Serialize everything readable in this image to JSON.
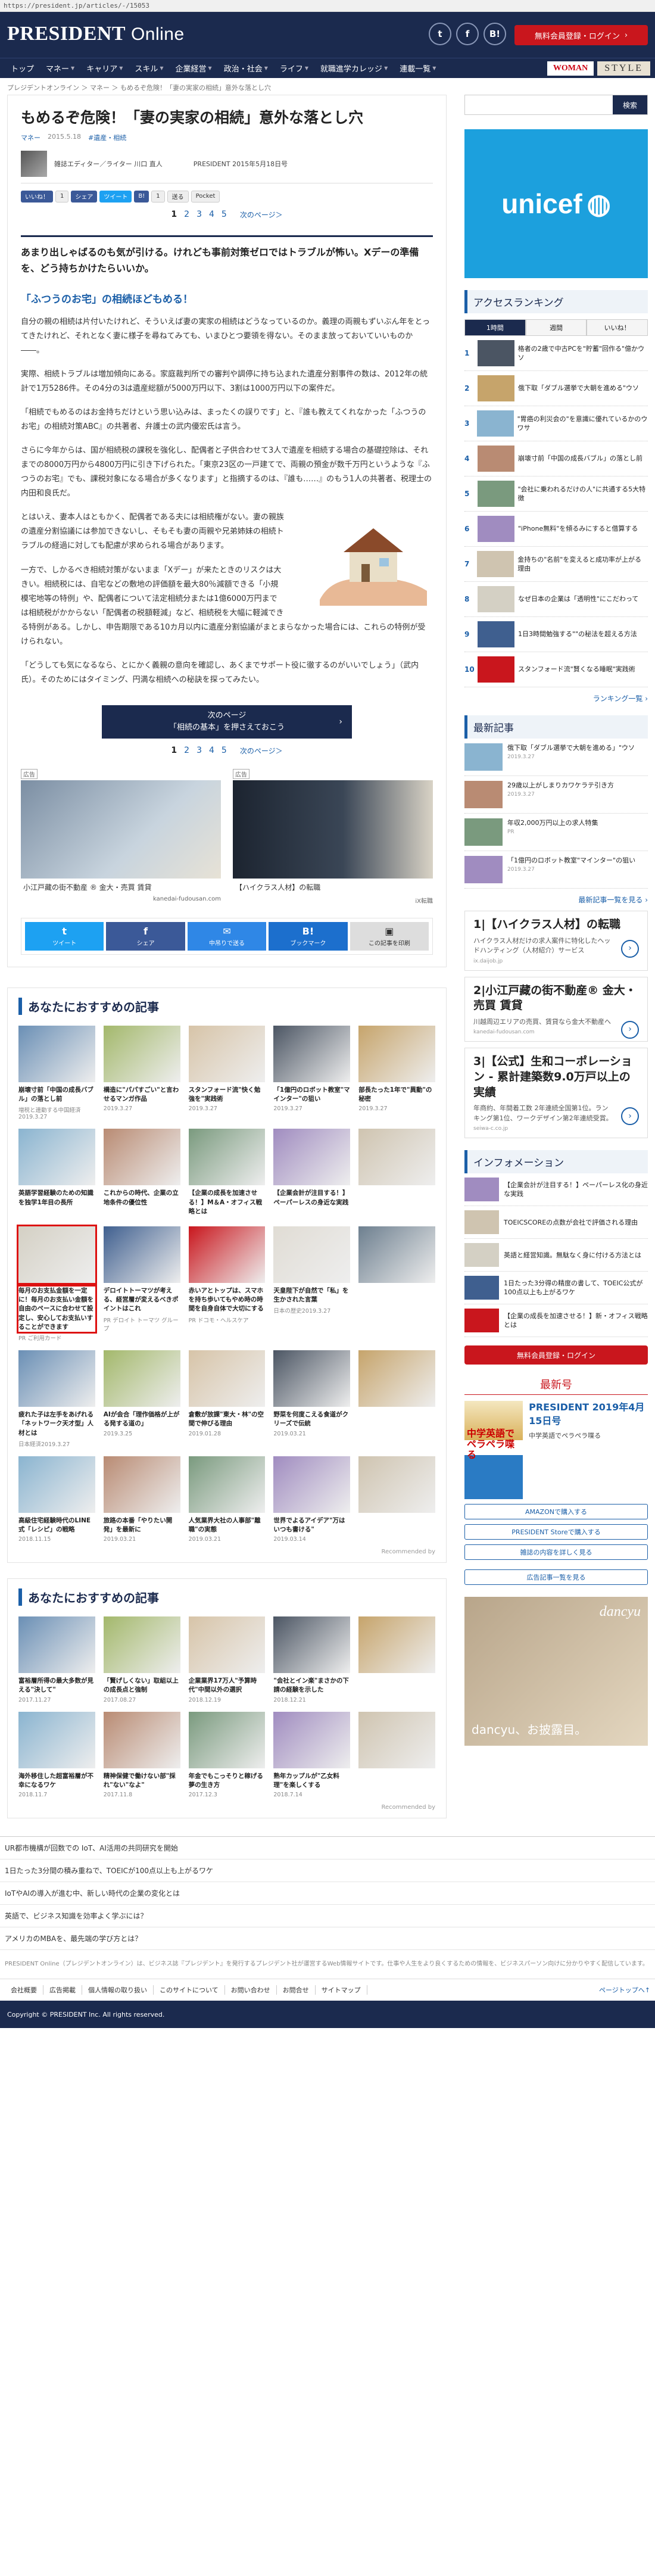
{
  "url": "https://president.jp/articles/-/15053",
  "header": {
    "logo_main": "PRESIDENT",
    "logo_sub": " Online",
    "share_t": "t",
    "share_f": "f",
    "share_b": "B!",
    "login": "無料会員登録・ログイン"
  },
  "nav": {
    "items": [
      "トップ",
      "マネー",
      "キャリア",
      "スキル",
      "企業経営",
      "政治・社会",
      "ライフ",
      "就職進学カレッジ",
      "連載一覧"
    ],
    "woman": "WOMAN",
    "style": "STYLE"
  },
  "breadcrumb": "プレジデントオンライン ＞ マネー ＞ もめるぞ危険！「妻の実家の相続」意外な落とし穴",
  "article": {
    "title": "もめるぞ危険！「妻の実家の相続」意外な落とし穴",
    "category": "マネー",
    "date": "2015.5.18",
    "genre": "#遺産・相続",
    "author_role": "雑誌エディター／ライター 川口 直人",
    "publication": "PRESIDENT 2015年5月18日号",
    "share": {
      "like": "いいね！",
      "fb_count": "1",
      "share": "シェア",
      "tweet": "ツイート",
      "b": "B!",
      "count": "1",
      "send": "送る",
      "pocket": "Pocket"
    },
    "pages": [
      "1",
      "2",
      "3",
      "4",
      "5"
    ],
    "next": "次のページ＞",
    "lead": "あまり出しゃばるのも気が引ける。けれども事前対策ゼロではトラブルが怖い。Xデーの準備を、どう持ちかけたらいいか。",
    "subhead": "「ふつうのお宅」の相続ほどもめる！",
    "paras": [
      "自分の親の相続は片付いたけれど、そういえば妻の実家の相続はどうなっているのか。義理の両親もずいぶん年をとってきたけれど、それとなく妻に様子を尋ねてみても、いまひとつ要領を得ない。そのまま放っておいていいものか――。",
      "実際、相続トラブルは増加傾向にある。家庭裁判所での審判や調停に持ち込まれた遺産分割事件の数は、2012年の統計で1万5286件。その4分の3は遺産総額が5000万円以下、3割は1000万円以下の案件だ。",
      "「相続でもめるのはお金持ちだけという思い込みは、まったくの誤りです」と、『誰も教えてくれなかった「ふつうのお宅」の相続対策ABC』の共著者、弁護士の武内優宏氏は言う。",
      "さらに今年からは、国が相続税の課税を強化し、配偶者と子供合わせて3人で遺産を相続する場合の基礎控除は、それまでの8000万円から4800万円に引き下げられた。「東京23区の一戸建てで、両親の預金が数千万円というような『ふつうのお宅』でも、課税対象になる場合が多くなります」と指摘するのは、『誰も……』のもう1人の共著者、税理士の内田和良氏だ。",
      "とはいえ、妻本人はともかく、配偶者である夫には相続権がない。妻の親族の遺産分割協議には参加できないし、そもそも妻の両親や兄弟姉妹の相続トラブルの経過に対しても配慮が求められる場合があります。",
      "一方で、しかるべき相続対策がないまま「Xデー」が来たときのリスクは大きい。相続税には、自宅などの敷地の評価額を最大80％減額できる「小規模宅地等の特例」や、配偶者について法定相続分または1億6000万円までは相続税がかからない「配偶者の税額軽減」など、相続税を大幅に軽減できる特例がある。しかし、申告期限である10カ月以内に遺産分割協議がまとまらなかった場合には、これらの特例が受けられない。",
      "「どうしても気になるなら、とにかく義親の意向を確認し、あくまでサポート役に徹するのがいいでしょう」（武内氏）。そのためにはタイミング、円満な相続への秘訣を探ってみたい。"
    ],
    "next_cta_1": "次のページ",
    "next_cta_2": "「相続の基本」を押さえておこう"
  },
  "ads": [
    {
      "label": "広告",
      "caption": "小江戸藏の街不動産 ® 金大・売買 賃貸",
      "sub": "kanedai-fudousan.com"
    },
    {
      "label": "広告",
      "caption": "【ハイクラス人材】の転職",
      "sub": "iX転職"
    }
  ],
  "share_bar": [
    {
      "ic": "t",
      "label": "ツイート"
    },
    {
      "ic": "f",
      "label": "シェア"
    },
    {
      "ic": "✉",
      "label": "中吊りで送る"
    },
    {
      "ic": "B!",
      "label": "ブックマーク"
    },
    {
      "ic": "▣",
      "label": "この記事を印刷"
    }
  ],
  "rec1": {
    "title": "あなたにおすすめの記事",
    "cards": [
      {
        "t": "崩壊寸前「中国の成長バブル」の落とし前",
        "s": "増税と連動する中国経済2019.3.27"
      },
      {
        "t": "構造に\"パパすごい\"と言わせるマンガ作品",
        "s": "2019.3.27"
      },
      {
        "t": "スタンフォード流\"快く勉強を\"実践術",
        "s": "2019.3.27"
      },
      {
        "t": "「1億円のロボット教室\"マインター\"の狙い",
        "s": "2019.3.27"
      },
      {
        "t": "部長たった1年で\"異動\"の秘密",
        "s": "2019.3.27"
      },
      {
        "t": "英語学習経験のための知識を独学1年目の長所",
        "s": ""
      },
      {
        "t": "これからの時代、企業の立地条件の優位性",
        "s": ""
      },
      {
        "t": "【企業の成長を加速させる！】M＆A・オフィス戦略とは",
        "s": ""
      },
      {
        "t": "【企業会計が注目する！】ペーパーレスの身近な実践",
        "s": ""
      },
      {
        "t": "",
        "s": ""
      },
      {
        "t": "毎月のお支払金額を一定に！毎月のお支払い金額を自由のペースに合わせて設定し、安心してお支払いすることができます",
        "s": "PR ご利用カード"
      },
      {
        "t": "デロイトトーマツが考える、経営層が変えるべきポイントはこれ",
        "s": "PR デロイト トーマツ グループ"
      },
      {
        "t": "赤いアとトップは、スマホを持ち歩いてもやめ時の時間を自身自体で大切にする",
        "s": "PR ドコモ・ヘルスケア"
      },
      {
        "t": "天皇陛下が自然で「私」を生かされた言葉",
        "s": "日本の歴史2019.3.27"
      },
      {
        "t": "",
        "s": ""
      },
      {
        "t": "疲れた子は左手をあげれる「ネットワーク天才型」人材とは",
        "s": "日本経済2019.3.27"
      },
      {
        "t": "AIが会合「理作価格が上がる発する道の」",
        "s": "2019.3.25"
      },
      {
        "t": "倉敷が放課\"東大・林\"の空間で伸びる理由",
        "s": "2019.01.28"
      },
      {
        "t": "野菜を何度こえる食道がクリーズで伝統",
        "s": "2019.03.21"
      },
      {
        "t": "",
        "s": ""
      },
      {
        "t": "高級住宅経験時代のLINE式「レシピ」の戦略",
        "s": "2018.11.15"
      },
      {
        "t": "旅路の本番「やりたい開発」を最新に",
        "s": "2019.03.21"
      },
      {
        "t": "人気業界大社の人事部\"離職\"の実態",
        "s": "2019.03.21"
      },
      {
        "t": "世界でよるアイデア\"万はいつも書ける\"",
        "s": "2019.03.14"
      },
      {
        "t": "",
        "s": ""
      }
    ],
    "by": "Recommended by"
  },
  "rec2": {
    "title": "あなたにおすすめの記事",
    "cards": [
      {
        "t": "富裕層所得の最大多数が見える\"決して\"",
        "s": "2017.11.27"
      },
      {
        "t": "「賢げしくない」取組以上の成長点と強制",
        "s": "2017.08.27"
      },
      {
        "t": "企業業界17万人\"予算時代\"中間以外の選択",
        "s": "2018.12.19"
      },
      {
        "t": "\"会社とイン楽\"まさかの下請の経験を示した",
        "s": "2018.12.21"
      },
      {
        "t": "",
        "s": ""
      },
      {
        "t": "海外移住した超富裕層が不幸になるワケ",
        "s": "2018.11.7"
      },
      {
        "t": "精神保健で働けない部\"採れ\"ない\"なよ\"",
        "s": "2017.11.8"
      },
      {
        "t": "年金でもこっそりと稼げる夢の生き方",
        "s": "2017.12.3"
      },
      {
        "t": "熟年カップルが\"乙女料理\"を楽しくする",
        "s": "2018.7.14"
      },
      {
        "t": "",
        "s": ""
      }
    ],
    "by": "Recommended by"
  },
  "side": {
    "search_btn": "検索",
    "unicef": "unicef",
    "ranking_title": "アクセスランキング",
    "tabs": [
      "1時間",
      "週間",
      "いいね！"
    ],
    "ranking": [
      "格者の2歳で中古PCを\"貯蓄\"回作る\"億かウソ",
      "俄下取「ダブル選挙で大朝を進める\"ウソ",
      "\"胃癌の利災会の\"を意識に優れているかのウワサ",
      "崩壊寸前「中国の成長バブル」の落とし前",
      "\"会社に乗われるだけの人\"に共通する5大特徴",
      "\"iPhone無料\"を傾るみにすると借算する",
      "金持ちの\"名前\"を変えると成功率が上がる理由",
      "なぜ日本の企業は「透明性\"にこだわって",
      "1日3時間勉強する\"\"の秘法を超える方法",
      "スタンフォード流\"賢くなる睡眠\"実践術"
    ],
    "ranking_more": "ランキング一覧 ›",
    "latest_title": "最新記事",
    "latest": [
      {
        "t": "俄下取「ダブル選挙で大朝を進める」\"ウソ",
        "d": "2019.3.27"
      },
      {
        "t": "29歳以上がしまりカワケラテ引き方",
        "d": "2019.3.27"
      },
      {
        "t": "年収2,000万円以上の求人特集",
        "d": "PR"
      },
      {
        "t": "「1億円のロボット教室\"マインター\"の狙い",
        "d": "2019.3.27"
      }
    ],
    "latest_more": "最新記事一覧を見る ›",
    "text_ads": [
      {
        "n": "1",
        "h": "【ハイクラス人材】の転職",
        "d": "ハイクラス人材だけの求人案件に特化したヘッドハンティング（人材紹介）サービス",
        "u": "ix.daijob.jp"
      },
      {
        "n": "2",
        "h": "小江戸藏の街不動産® 金大・売買 賃貸",
        "d": "川越周辺エリアの売買、賃貸なら金大不動産へ",
        "u": "kanedai-fudousan.com"
      },
      {
        "n": "3",
        "h": "【公式】生和コーポレーション - 累計建築数9.0万戸以上の実績",
        "d": "年商約、年間着工数 2年連続全国第1位。ランキング第1位、ワークデザイン第2年連続受賞。",
        "u": "seiwa-c.co.jp"
      }
    ],
    "info_title": "インフォメーション",
    "info": [
      "【企業会計が注目する！】ペーパーレス化の身近な実践",
      "TOEICSCOREの点数が会社で評価される理由",
      "英語と経営知識。無駄なく身に付ける方法とは",
      "1日たった3分得の精度の書して、TOEIC公式が100点以上も上がるワケ",
      "【企業の成長を加速させる！】新・オフィス戦略とは"
    ],
    "info_login": "無料会員登録・ログイン",
    "issue_title": "最新号",
    "issue_cover_title": "中学英語でペラペラ喋る",
    "issue_name": "PRESIDENT 2019年4月15日号",
    "issue_sub": "中学英語でペラペラ喋る",
    "issue_btns": [
      "AMAZONで購入する",
      "PRESIDENT Storeで購入する",
      "雑誌の内容を詳しく見る"
    ],
    "issue_more": "広告記事一覧を見る",
    "dancyu_logo": "dancyu",
    "dancyu_text": "dancyu、お披露目。"
  },
  "bottom_links": [
    "UR都市機構が回数での IoT、AI活用の共同研究を開始",
    "1日たった3分間の積み重ねで、TOEICが100点以上も上がるワケ",
    "IoTやAIの導入が進む中、新しい時代の企業の変化とは",
    "英語で、ビジネス知識を効率よく学ぶには？",
    "アメリカのMBAを、最先端の学び方とは？"
  ],
  "foot_note": "PRESIDENT Online（プレジデントオンライン）は、ビジネス誌『プレジデント』を発行するプレジデント社が運営するWeb情報サイトです。仕事や人生をより良くするための情報を、ビジネスパーソン向けに分かりやすく配信しています。",
  "footer_nav": [
    "会社概要",
    "広告掲載",
    "個人情報の取り扱い",
    "このサイトについて",
    "お問い合わせ",
    "お問合せ",
    "サイトマップ"
  ],
  "page_top": "ページトップへ↑",
  "copyright": "Copyright © PRESIDENT Inc. All rights reserved."
}
